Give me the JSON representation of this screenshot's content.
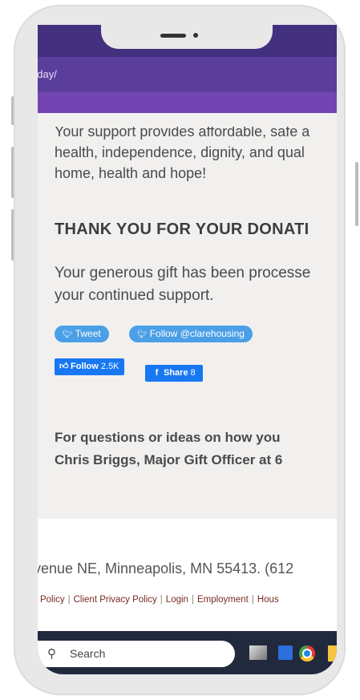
{
  "browser": {
    "url_fragment": "oday/"
  },
  "page": {
    "intro_lines": [
      "Your support provides affordable, safe a",
      "health, independence, dignity, and qual",
      "home, health and hope!"
    ],
    "heading": "THANK YOU FOR YOUR DONATI",
    "confirmation_lines": [
      "Your generous gift has been processe",
      "your continued support."
    ],
    "social": {
      "tweet_label": "Tweet",
      "follow_twitter_label": "Follow @clarehousing",
      "fb_follow_label": "Follow",
      "fb_follow_count": "2.5K",
      "fb_share_label": "Share",
      "fb_share_count": "8"
    },
    "questions_lines": [
      "For questions or ideas on how you",
      "Chris Briggs, Major Gift Officer at 6"
    ]
  },
  "footer": {
    "address": "venue NE, Minneapolis, MN 55413. (612",
    "links": [
      "y Policy",
      "Client Privacy Policy",
      "Login",
      "Employment",
      "Hous"
    ]
  },
  "taskbar": {
    "search_placeholder": "Search",
    "icons": [
      "task-view-icon",
      "app-icon",
      "chrome-icon",
      "file-explorer-icon"
    ]
  },
  "colors": {
    "header_dark": "#43307f",
    "header_mid": "#5b3e9c",
    "header_band": "#7245b3",
    "twitter_blue": "#4a9fe6",
    "facebook_blue": "#1877f2",
    "footer_link": "#7a2b22",
    "taskbar": "#212a3d"
  }
}
